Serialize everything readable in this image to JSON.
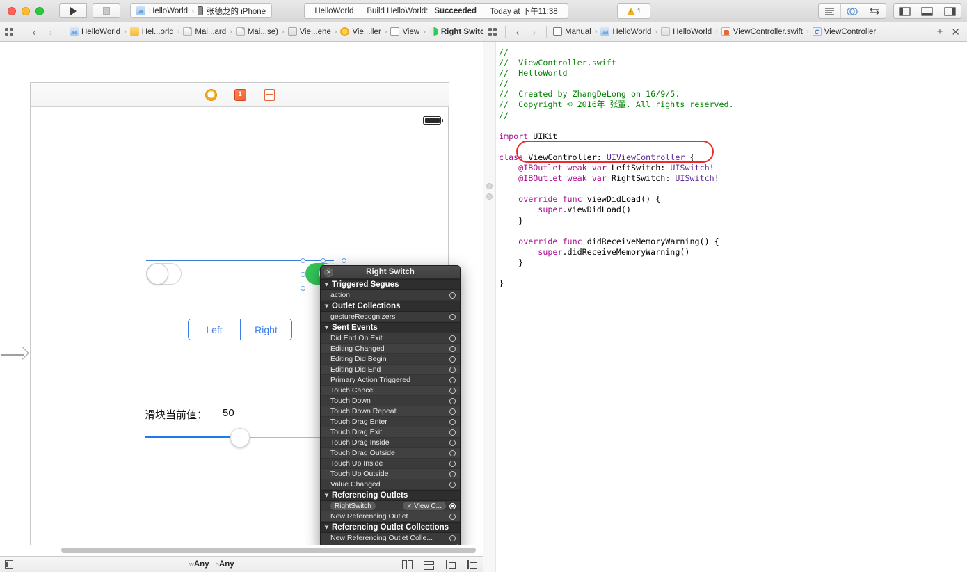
{
  "toolbar": {
    "run_label": "run-button",
    "stop_label": "stop-button",
    "scheme": {
      "project": "HelloWorld",
      "separator": "›",
      "device": "张德龙的 iPhone"
    },
    "status": {
      "project": "HelloWorld",
      "action": "Build HelloWorld:",
      "result": "Succeeded",
      "time": "Today at 下午11:38"
    },
    "warning_count": "1"
  },
  "jumpbar_left": {
    "back": "‹",
    "forward": "›",
    "crumbs": [
      {
        "label": "HelloWorld",
        "icon": "project-icon"
      },
      {
        "label": "Hel...orld",
        "icon": "folder-icon"
      },
      {
        "label": "Mai...ard",
        "icon": "file-icon"
      },
      {
        "label": "Mai...se)",
        "icon": "file-icon"
      },
      {
        "label": "Vie...ene",
        "icon": "scene-icon"
      },
      {
        "label": "Vie...ller",
        "icon": "view-controller-icon"
      },
      {
        "label": "View",
        "icon": "view-icon"
      },
      {
        "label": "Right Switch",
        "icon": "switch-icon"
      }
    ]
  },
  "jumpbar_right": {
    "back": "‹",
    "forward": "›",
    "crumbs": [
      {
        "label": "Manual",
        "icon": "manual-icon"
      },
      {
        "label": "HelloWorld",
        "icon": "project-icon"
      },
      {
        "label": "HelloWorld",
        "icon": "folder-gray-icon"
      },
      {
        "label": "ViewController.swift",
        "icon": "swift-file-icon"
      },
      {
        "label": "ViewController",
        "icon": "class-icon",
        "badge": "C"
      }
    ],
    "add": "+",
    "close": "✕"
  },
  "canvas": {
    "scene_dock": [
      "view-controller-icon",
      "first-responder-icon",
      "exit-icon"
    ],
    "left_switch": {
      "name": "Left Switch",
      "state": "off"
    },
    "right_switch": {
      "name": "Right Switch",
      "state": "on"
    },
    "segmented": {
      "options": [
        "Left",
        "Right"
      ],
      "selected": "Left"
    },
    "slider_label": "滑块当前值：",
    "slider_value": "50",
    "bottom_bar": {
      "size_class_w_key": "w",
      "size_class_w_value": "Any",
      "size_class_h_key": "h",
      "size_class_h_value": "Any"
    }
  },
  "hud": {
    "title": "Right Switch",
    "close": "✕",
    "sections": [
      {
        "name": "Triggered Segues",
        "rows": [
          {
            "label": "action",
            "connected": false
          }
        ]
      },
      {
        "name": "Outlet Collections",
        "rows": [
          {
            "label": "gestureRecognizers",
            "connected": false
          }
        ]
      },
      {
        "name": "Sent Events",
        "rows": [
          {
            "label": "Did End On Exit",
            "connected": false
          },
          {
            "label": "Editing Changed",
            "connected": false
          },
          {
            "label": "Editing Did Begin",
            "connected": false
          },
          {
            "label": "Editing Did End",
            "connected": false
          },
          {
            "label": "Primary Action Triggered",
            "connected": false
          },
          {
            "label": "Touch Cancel",
            "connected": false
          },
          {
            "label": "Touch Down",
            "connected": false
          },
          {
            "label": "Touch Down Repeat",
            "connected": false
          },
          {
            "label": "Touch Drag Enter",
            "connected": false
          },
          {
            "label": "Touch Drag Exit",
            "connected": false
          },
          {
            "label": "Touch Drag Inside",
            "connected": false
          },
          {
            "label": "Touch Drag Outside",
            "connected": false
          },
          {
            "label": "Touch Up Inside",
            "connected": false
          },
          {
            "label": "Touch Up Outside",
            "connected": false
          },
          {
            "label": "Value Changed",
            "connected": false
          }
        ]
      },
      {
        "name": "Referencing Outlets",
        "rows": [
          {
            "label": "RightSwitch",
            "connected": true,
            "target": "View C...",
            "remove": "✕"
          },
          {
            "label": "New Referencing Outlet",
            "connected": false
          }
        ]
      },
      {
        "name": "Referencing Outlet Collections",
        "rows": [
          {
            "label": "New Referencing Outlet Colle...",
            "connected": false
          }
        ]
      }
    ]
  },
  "editor": {
    "lines": [
      [
        {
          "t": "//",
          "c": "cmt"
        }
      ],
      [
        {
          "t": "//  ViewController.swift",
          "c": "cmt"
        }
      ],
      [
        {
          "t": "//  HelloWorld",
          "c": "cmt"
        }
      ],
      [
        {
          "t": "//",
          "c": "cmt"
        }
      ],
      [
        {
          "t": "//  Created by ZhangDeLong on 16/9/5.",
          "c": "cmt"
        }
      ],
      [
        {
          "t": "//  Copyright © 2016年 张董. All rights reserved.",
          "c": "cmt"
        }
      ],
      [
        {
          "t": "//",
          "c": "cmt"
        }
      ],
      [
        {
          "t": "",
          "c": "id"
        }
      ],
      [
        {
          "t": "import",
          "c": "kw"
        },
        {
          "t": " UIKit",
          "c": "id"
        }
      ],
      [
        {
          "t": "",
          "c": "id"
        }
      ],
      [
        {
          "t": "class",
          "c": "kw"
        },
        {
          "t": " ViewController: ",
          "c": "id"
        },
        {
          "t": "UIViewController",
          "c": "type"
        },
        {
          "t": " {",
          "c": "id"
        }
      ],
      [
        {
          "t": "    ",
          "c": "id"
        },
        {
          "t": "@IBOutlet",
          "c": "attr"
        },
        {
          "t": " ",
          "c": "id"
        },
        {
          "t": "weak",
          "c": "kw"
        },
        {
          "t": " ",
          "c": "id"
        },
        {
          "t": "var",
          "c": "kw"
        },
        {
          "t": " LeftSwitch: ",
          "c": "id"
        },
        {
          "t": "UISwitch",
          "c": "type"
        },
        {
          "t": "!",
          "c": "id"
        }
      ],
      [
        {
          "t": "    ",
          "c": "id"
        },
        {
          "t": "@IBOutlet",
          "c": "attr"
        },
        {
          "t": " ",
          "c": "id"
        },
        {
          "t": "weak",
          "c": "kw"
        },
        {
          "t": " ",
          "c": "id"
        },
        {
          "t": "var",
          "c": "kw"
        },
        {
          "t": " RightSwitch: ",
          "c": "id"
        },
        {
          "t": "UISwitch",
          "c": "type"
        },
        {
          "t": "!",
          "c": "id"
        }
      ],
      [
        {
          "t": "",
          "c": "id"
        }
      ],
      [
        {
          "t": "    ",
          "c": "id"
        },
        {
          "t": "override",
          "c": "kw"
        },
        {
          "t": " ",
          "c": "id"
        },
        {
          "t": "func",
          "c": "kw"
        },
        {
          "t": " viewDidLoad() {",
          "c": "id"
        }
      ],
      [
        {
          "t": "        ",
          "c": "id"
        },
        {
          "t": "super",
          "c": "kw"
        },
        {
          "t": ".viewDidLoad()",
          "c": "id"
        }
      ],
      [
        {
          "t": "    }",
          "c": "id"
        }
      ],
      [
        {
          "t": "",
          "c": "id"
        }
      ],
      [
        {
          "t": "    ",
          "c": "id"
        },
        {
          "t": "override",
          "c": "kw"
        },
        {
          "t": " ",
          "c": "id"
        },
        {
          "t": "func",
          "c": "kw"
        },
        {
          "t": " didReceiveMemoryWarning() {",
          "c": "id"
        }
      ],
      [
        {
          "t": "        ",
          "c": "id"
        },
        {
          "t": "super",
          "c": "kw"
        },
        {
          "t": ".didReceiveMemoryWarning()",
          "c": "id"
        }
      ],
      [
        {
          "t": "    }",
          "c": "id"
        }
      ],
      [
        {
          "t": "",
          "c": "id"
        }
      ],
      [
        {
          "t": "}",
          "c": "id"
        }
      ]
    ]
  },
  "colors": {
    "switch_on": "#34c759",
    "accent_blue": "#3d7fe8",
    "annotation_red": "#ee2b2b",
    "slider_fill": "#1c7ced"
  }
}
